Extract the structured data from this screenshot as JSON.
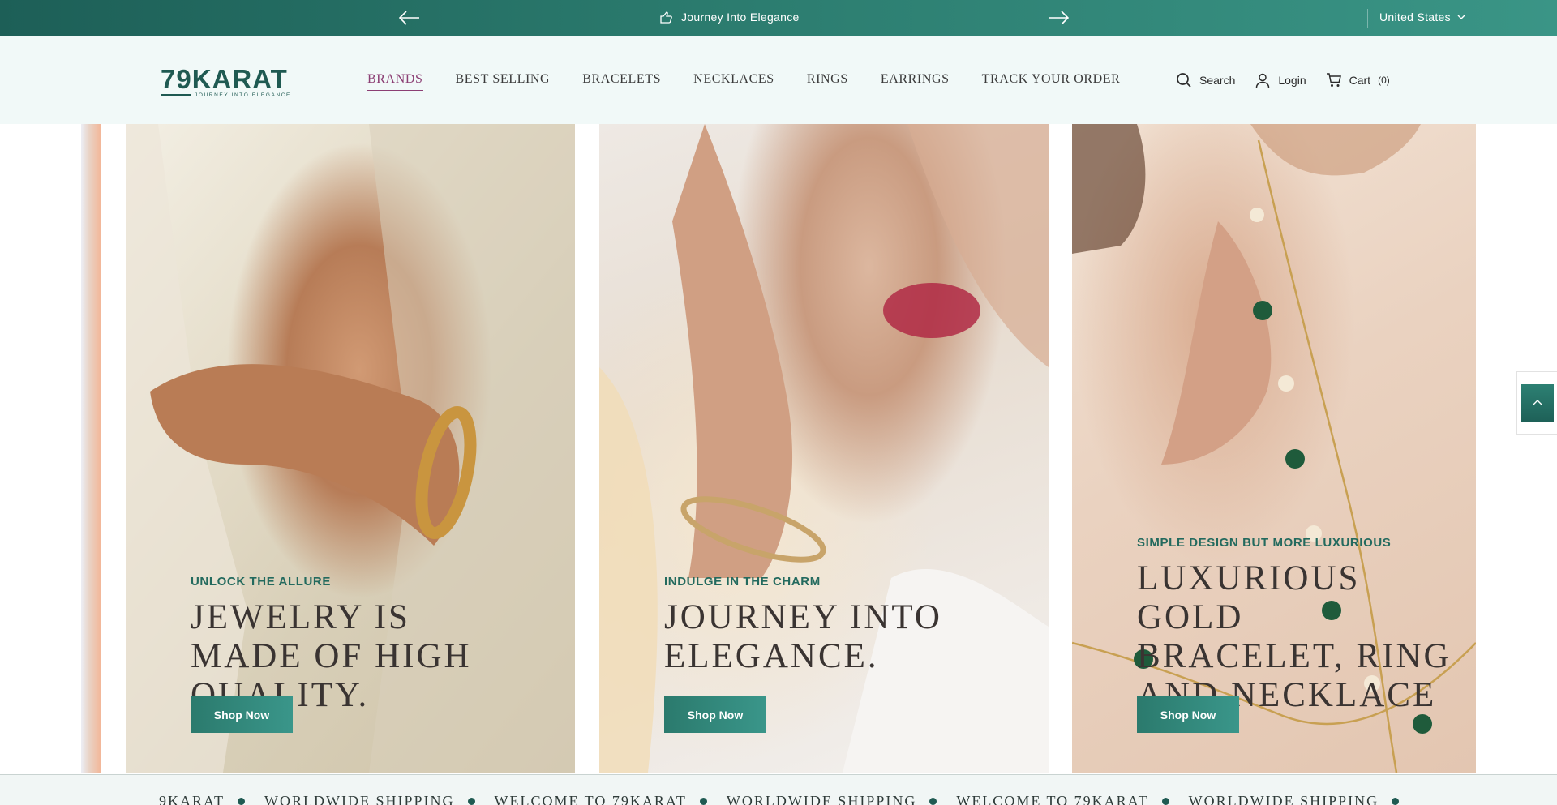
{
  "topbar": {
    "announcement": "Journey Into Elegance",
    "country": "United States",
    "icons": {
      "prev": "arrow-left-icon",
      "next": "arrow-right-icon",
      "announce": "hand-pointing-icon",
      "dropdown": "chevron-down-icon"
    }
  },
  "header": {
    "logo_word": "79KARAT",
    "logo_tagline": "JOURNEY INTO ELEGANCE",
    "nav": [
      "BRANDS",
      "BEST SELLING",
      "BRACELETS",
      "NECKLACES",
      "RINGS",
      "EARRINGS",
      "TRACK YOUR ORDER"
    ],
    "active_nav": "BRANDS",
    "search_label": "Search",
    "login_label": "Login",
    "cart_label": "Cart",
    "cart_count": "(0)"
  },
  "slides": [
    {
      "eyebrow": "UNLOCK THE ALLURE",
      "headline": "JEWELRY IS MADE OF HIGH QUALITY.",
      "button": "Shop Now"
    },
    {
      "eyebrow": "INDULGE IN THE CHARM",
      "headline": "JOURNEY INTO ELEGANCE.",
      "button": "Shop Now"
    },
    {
      "eyebrow": "SIMPLE DESIGN BUT MORE LUXURIOUS",
      "headline": "LUXURIOUS GOLD BRACELET, RING AND NECKLACE",
      "button": "Shop Now"
    }
  ],
  "marquee": [
    "9KARAT",
    "WORLDWIDE SHIPPING",
    "WELCOME TO 79KARAT",
    "WORLDWIDE SHIPPING",
    "WELCOME TO 79KARAT",
    "WORLDWIDE SHIPPING"
  ],
  "colors": {
    "brand": "#1f5a52",
    "accent": "#3a968a",
    "active_nav": "#8c3f74"
  }
}
